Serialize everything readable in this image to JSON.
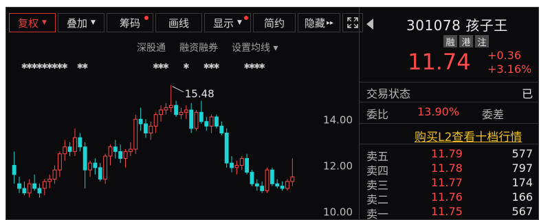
{
  "toolbar": {
    "buttons": [
      {
        "label": "复权",
        "caret": "▼",
        "active": true
      },
      {
        "label": "叠加",
        "caret": "▼"
      },
      {
        "label": "筹码",
        "dot": true
      },
      {
        "label": "画线"
      },
      {
        "label": "显示",
        "caret": "▼",
        "dot": true
      },
      {
        "label": "简约"
      },
      {
        "label": "隐藏",
        "suffix": "▸▸"
      }
    ]
  },
  "subbar": {
    "items": [
      "深股通",
      "融资融券",
      "设置均线 ▾"
    ]
  },
  "chart_data": {
    "type": "candlestick",
    "title": "",
    "xlabel": "",
    "ylabel": "",
    "ylim": [
      9.6,
      15.8
    ],
    "yticks": [
      "14.00",
      "12.00",
      "10.00"
    ],
    "annotation": "15.48",
    "candles": [
      [
        12.0,
        12.6,
        11.2,
        11.6
      ],
      [
        11.2,
        11.5,
        10.8,
        11.0
      ],
      [
        11.0,
        11.3,
        10.7,
        10.8
      ],
      [
        10.8,
        11.4,
        10.6,
        11.2
      ],
      [
        11.2,
        11.6,
        10.9,
        11.0
      ],
      [
        11.0,
        11.2,
        10.6,
        10.8
      ],
      [
        11.0,
        11.4,
        10.7,
        11.3
      ],
      [
        11.3,
        11.6,
        11.0,
        11.4
      ],
      [
        11.4,
        12.0,
        11.2,
        11.8
      ],
      [
        11.8,
        12.6,
        11.5,
        12.5
      ],
      [
        12.5,
        13.1,
        12.2,
        12.8
      ],
      [
        12.8,
        13.0,
        12.4,
        12.6
      ],
      [
        12.6,
        13.6,
        12.4,
        13.2
      ],
      [
        13.2,
        13.4,
        12.6,
        12.8
      ],
      [
        12.8,
        13.0,
        11.0,
        11.8
      ],
      [
        11.8,
        12.2,
        11.5,
        12.1
      ],
      [
        12.1,
        12.3,
        11.6,
        11.9
      ],
      [
        11.9,
        12.1,
        11.3,
        11.4
      ],
      [
        11.4,
        12.5,
        11.2,
        12.4
      ],
      [
        12.4,
        12.9,
        12.0,
        12.8
      ],
      [
        12.8,
        13.1,
        12.3,
        12.6
      ],
      [
        12.6,
        12.9,
        12.1,
        12.3
      ],
      [
        12.3,
        12.7,
        11.9,
        12.6
      ],
      [
        12.6,
        13.0,
        12.4,
        12.7
      ],
      [
        12.7,
        14.2,
        12.5,
        14.0
      ],
      [
        14.0,
        14.5,
        13.5,
        13.8
      ],
      [
        13.8,
        14.0,
        13.2,
        13.4
      ],
      [
        13.4,
        13.9,
        13.1,
        13.7
      ],
      [
        13.7,
        14.3,
        13.4,
        14.2
      ],
      [
        14.2,
        14.6,
        13.9,
        14.4
      ],
      [
        14.4,
        14.7,
        14.2,
        14.5
      ],
      [
        14.5,
        15.48,
        14.3,
        14.6
      ],
      [
        14.6,
        14.8,
        14.1,
        14.2
      ],
      [
        14.2,
        14.5,
        14.0,
        14.3
      ],
      [
        14.3,
        14.6,
        14.0,
        14.4
      ],
      [
        14.4,
        14.7,
        13.4,
        13.6
      ],
      [
        13.6,
        14.4,
        13.5,
        14.3
      ],
      [
        14.3,
        14.8,
        13.8,
        13.9
      ],
      [
        13.9,
        14.1,
        13.5,
        13.7
      ],
      [
        13.7,
        14.2,
        13.4,
        14.1
      ],
      [
        14.1,
        14.2,
        13.6,
        13.7
      ],
      [
        13.7,
        13.9,
        13.3,
        13.4
      ],
      [
        13.4,
        13.6,
        11.9,
        12.1
      ],
      [
        12.1,
        12.4,
        11.7,
        11.9
      ],
      [
        11.9,
        12.2,
        11.6,
        12.0
      ],
      [
        12.0,
        12.4,
        11.8,
        12.3
      ],
      [
        12.3,
        12.5,
        11.6,
        11.7
      ],
      [
        11.7,
        11.8,
        11.1,
        11.2
      ],
      [
        11.2,
        11.4,
        10.9,
        11.1
      ],
      [
        11.1,
        11.3,
        10.8,
        10.9
      ],
      [
        10.9,
        11.9,
        10.8,
        11.8
      ],
      [
        11.8,
        11.9,
        11.1,
        11.2
      ],
      [
        11.2,
        11.4,
        11.0,
        11.1
      ],
      [
        11.1,
        11.3,
        10.9,
        11.0
      ],
      [
        11.0,
        11.4,
        10.9,
        11.3
      ],
      [
        11.3,
        12.3,
        11.1,
        11.5
      ]
    ]
  },
  "quote": {
    "code_name": "301078 孩子王",
    "badges": [
      "融",
      "港",
      "注"
    ],
    "price": "11.74",
    "change": "+0.36",
    "change_pct": "+3.16%"
  },
  "status": {
    "label": "交易状态",
    "value": "已"
  },
  "ratio": {
    "label": "委比",
    "value": "13.90%",
    "diff_label": "委差"
  },
  "l2_link": "购买L2查看十档行情",
  "orderbook": [
    {
      "name": "卖五",
      "price": "11.79",
      "vol": "577"
    },
    {
      "name": "卖四",
      "price": "11.78",
      "vol": "797"
    },
    {
      "name": "卖三",
      "price": "11.77",
      "vol": "174"
    },
    {
      "name": "卖二",
      "price": "11.76",
      "vol": "166"
    },
    {
      "name": "卖一",
      "price": "11.75",
      "vol": "567"
    }
  ],
  "colors": {
    "up": "#ff4a4a",
    "down": "#1fd3d3",
    "accent": "#e2413a",
    "link": "#f0c020"
  }
}
